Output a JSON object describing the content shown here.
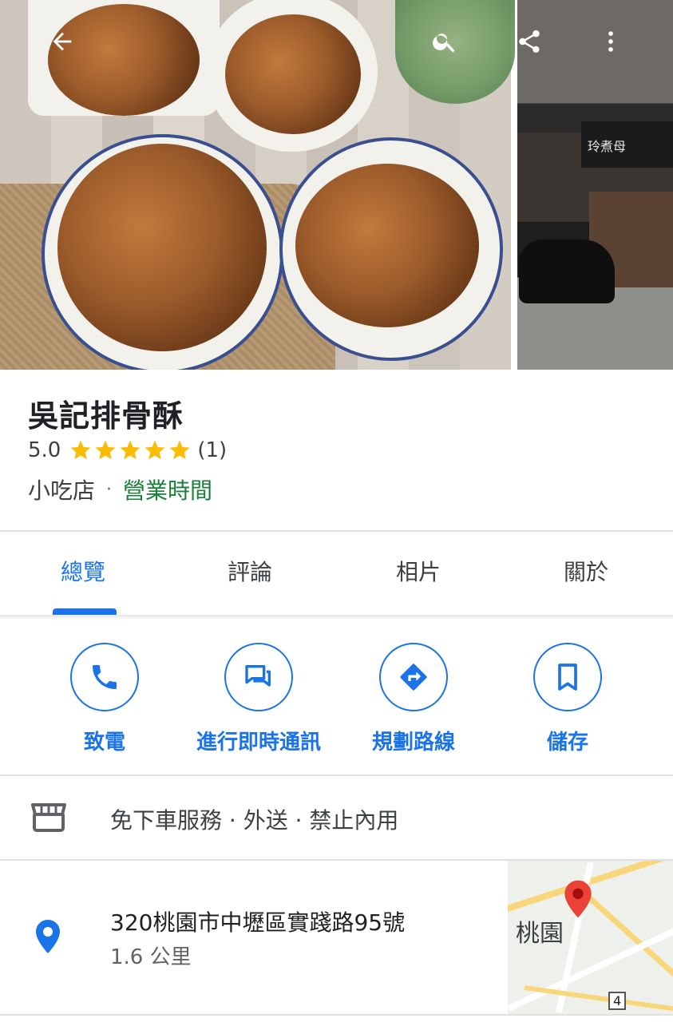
{
  "place": {
    "name": "吳記排骨酥",
    "rating": "5.0",
    "stars": 5,
    "review_count": "(1)",
    "category": "小吃店",
    "separator": "·",
    "hours_label": "營業時間"
  },
  "side_photo": {
    "sign_text": "玲煮母"
  },
  "tabs": [
    {
      "label": "總覽",
      "active": true
    },
    {
      "label": "評論",
      "active": false
    },
    {
      "label": "相片",
      "active": false
    },
    {
      "label": "關於",
      "active": false
    }
  ],
  "actions": [
    {
      "label": "致電",
      "icon": "phone-icon"
    },
    {
      "label": "進行即時通訊",
      "icon": "chat-icon"
    },
    {
      "label": "規劃路線",
      "icon": "directions-icon"
    },
    {
      "label": "儲存",
      "icon": "bookmark-icon"
    }
  ],
  "services": {
    "icon": "storefront-icon",
    "text": "免下車服務 · 外送 · 禁止內用"
  },
  "address": {
    "street": "320桃園市中壢區實踐路95號",
    "distance": "1.6 公里",
    "map_city_label": "桃園",
    "map_badge": "4"
  },
  "colors": {
    "accent": "#1a73e8",
    "open_green": "#188038",
    "star": "#fbbc04",
    "pin": "#ea4335"
  }
}
